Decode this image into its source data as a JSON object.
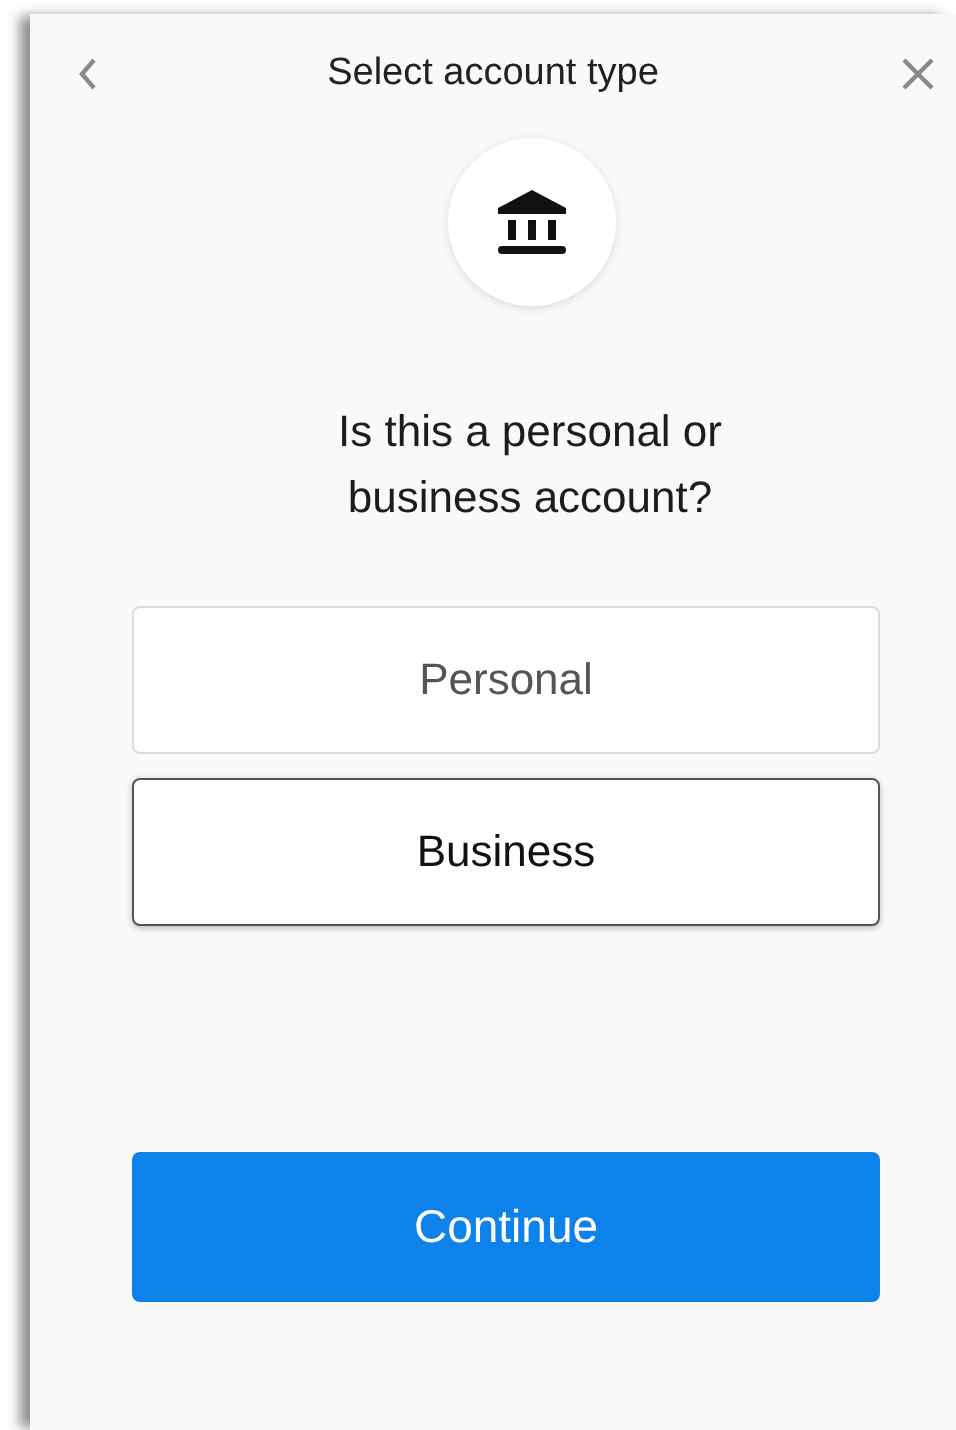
{
  "header": {
    "title": "Select account type"
  },
  "question": "Is this a personal or business account?",
  "options": [
    {
      "label": "Personal",
      "selected": false
    },
    {
      "label": "Business",
      "selected": true
    }
  ],
  "primary_button": {
    "label": "Continue"
  }
}
